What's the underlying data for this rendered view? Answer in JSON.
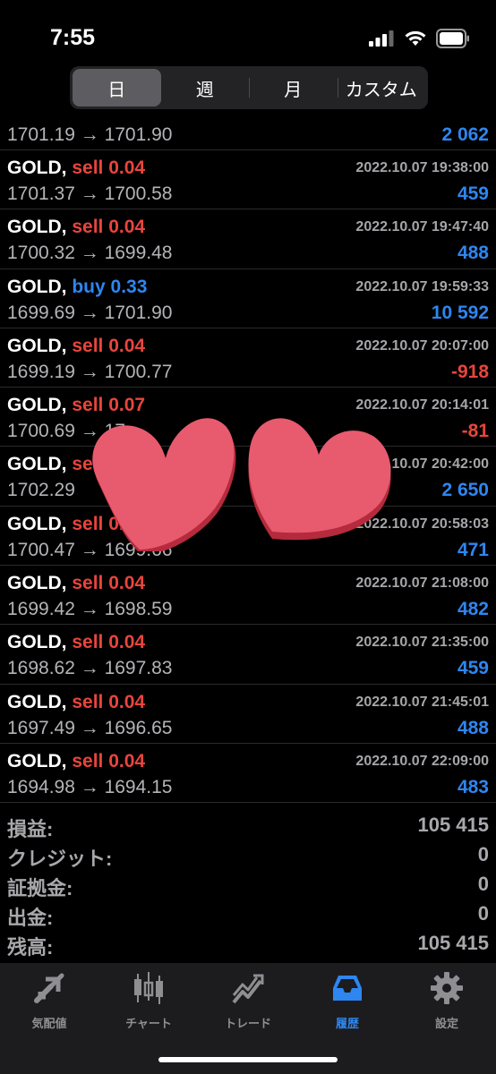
{
  "status_bar": {
    "time": "7:55"
  },
  "period_tabs": [
    {
      "label": "日",
      "active": true
    },
    {
      "label": "週",
      "active": false
    },
    {
      "label": "月",
      "active": false
    },
    {
      "label": "カスタム",
      "active": false
    }
  ],
  "history": {
    "partial_first": {
      "prices": "1701.19 → 1701.90",
      "profit": "2 062",
      "profit_sign": "pos"
    },
    "rows": [
      {
        "symbol": "GOLD,",
        "side": "sell 0.04",
        "side_type": "sell",
        "time": "2022.10.07 19:38:00",
        "prices": "1701.37 → 1700.58",
        "profit": "459",
        "profit_sign": "pos"
      },
      {
        "symbol": "GOLD,",
        "side": "sell 0.04",
        "side_type": "sell",
        "time": "2022.10.07 19:47:40",
        "prices": "1700.32 → 1699.48",
        "profit": "488",
        "profit_sign": "pos"
      },
      {
        "symbol": "GOLD,",
        "side": "buy 0.33",
        "side_type": "buy",
        "time": "2022.10.07 19:59:33",
        "prices": "1699.69 → 1701.90",
        "profit": "10 592",
        "profit_sign": "pos"
      },
      {
        "symbol": "GOLD,",
        "side": "sell 0.04",
        "side_type": "sell",
        "time": "2022.10.07 20:07:00",
        "prices": "1699.19 → 1700.77",
        "profit": "-918",
        "profit_sign": "neg"
      },
      {
        "symbol": "GOLD,",
        "side": "sell 0.07",
        "side_type": "sell",
        "time": "2022.10.07 20:14:01",
        "prices": "1700.69 → 17",
        "profit": "-81",
        "profit_sign": "neg"
      },
      {
        "symbol": "GOLD,",
        "side": "se",
        "side_type": "sell",
        "time": "2022.10.07 20:42:00",
        "prices": "1702.29",
        "profit": "2 650",
        "profit_sign": "pos"
      },
      {
        "symbol": "GOLD,",
        "side": "sell 0.04",
        "side_type": "sell",
        "time": "2022.10.07 20:58:03",
        "prices": "1700.47 → 1699.66",
        "profit": "471",
        "profit_sign": "pos"
      },
      {
        "symbol": "GOLD,",
        "side": "sell 0.04",
        "side_type": "sell",
        "time": "2022.10.07 21:08:00",
        "prices": "1699.42 → 1698.59",
        "profit": "482",
        "profit_sign": "pos"
      },
      {
        "symbol": "GOLD,",
        "side": "sell 0.04",
        "side_type": "sell",
        "time": "2022.10.07 21:35:00",
        "prices": "1698.62 → 1697.83",
        "profit": "459",
        "profit_sign": "pos"
      },
      {
        "symbol": "GOLD,",
        "side": "sell 0.04",
        "side_type": "sell",
        "time": "2022.10.07 21:45:01",
        "prices": "1697.49 → 1696.65",
        "profit": "488",
        "profit_sign": "pos"
      },
      {
        "symbol": "GOLD,",
        "side": "sell 0.04",
        "side_type": "sell",
        "time": "2022.10.07 22:09:00",
        "prices": "1694.98 → 1694.15",
        "profit": "483",
        "profit_sign": "pos"
      }
    ]
  },
  "summary": [
    {
      "label": "損益:",
      "value": "105 415"
    },
    {
      "label": "クレジット:",
      "value": "0"
    },
    {
      "label": "証拠金:",
      "value": "0"
    },
    {
      "label": "出金:",
      "value": "0"
    },
    {
      "label": "残高:",
      "value": "105 415"
    }
  ],
  "tabbar": [
    {
      "label": "気配値",
      "icon": "quotes-arrows-icon",
      "active": false
    },
    {
      "label": "チャート",
      "icon": "candlestick-chart-icon",
      "active": false
    },
    {
      "label": "トレード",
      "icon": "trade-chart-icon",
      "active": false
    },
    {
      "label": "履歴",
      "icon": "history-inbox-icon",
      "active": true
    },
    {
      "label": "設定",
      "icon": "gear-icon",
      "active": false
    }
  ],
  "colors": {
    "sell": "#e8453c",
    "buy": "#2e86f0",
    "positive": "#2e86f0",
    "negative": "#e8453c",
    "heart": "#e85a6e"
  }
}
